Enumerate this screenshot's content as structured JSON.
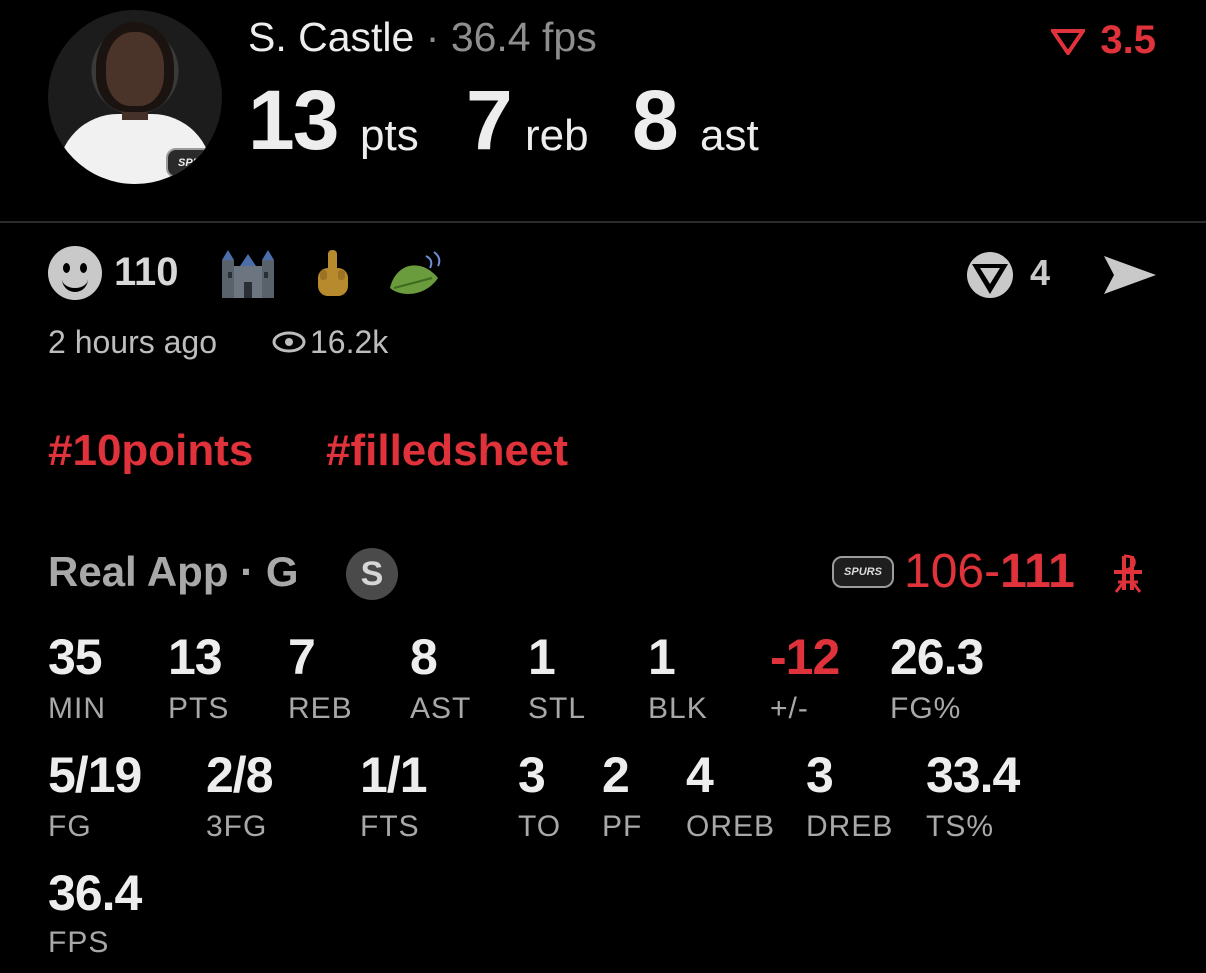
{
  "player": {
    "name": "S. Castle",
    "separator": "·",
    "fps_label": "36.4 fps",
    "team_badge": "SPURS",
    "headline": [
      {
        "value": "13",
        "unit": "pts"
      },
      {
        "value": "7",
        "unit": "reb"
      },
      {
        "value": "8",
        "unit": "ast"
      }
    ],
    "delta": "3.5",
    "delta_color": "#e0323a"
  },
  "engagement": {
    "reaction_count": "110",
    "reaction_icons": [
      "smiley-icon",
      "castle-icon",
      "middle-finger-icon",
      "leaf-icon"
    ],
    "vote_count": "4",
    "time_ago": "2 hours ago",
    "views": "16.2k"
  },
  "hashtags": [
    "#10points",
    "#filledsheet"
  ],
  "game": {
    "source": "Real App",
    "separator": "·",
    "position": "G",
    "badge_letter": "S",
    "team_logo": "SPURS",
    "score_team": "106",
    "score_dash": "-",
    "score_opponent": "111",
    "opponent_icon": "rockets-icon"
  },
  "stats": {
    "row1": [
      {
        "value": "35",
        "label": "MIN"
      },
      {
        "value": "13",
        "label": "PTS"
      },
      {
        "value": "7",
        "label": "REB"
      },
      {
        "value": "8",
        "label": "AST"
      },
      {
        "value": "1",
        "label": "STL"
      },
      {
        "value": "1",
        "label": "BLK"
      },
      {
        "value": "-12",
        "label": "+/-"
      },
      {
        "value": "26.3",
        "label": "FG%"
      }
    ],
    "row2": [
      {
        "value": "5/19",
        "label": "FG"
      },
      {
        "value": "2/8",
        "label": "3FG"
      },
      {
        "value": "1/1",
        "label": "FTS"
      },
      {
        "value": "3",
        "label": "TO"
      },
      {
        "value": "2",
        "label": "PF"
      },
      {
        "value": "4",
        "label": "OREB"
      },
      {
        "value": "3",
        "label": "DREB"
      },
      {
        "value": "33.4",
        "label": "TS%"
      }
    ],
    "row3": [
      {
        "value": "36.4",
        "label": "FPS"
      }
    ]
  }
}
